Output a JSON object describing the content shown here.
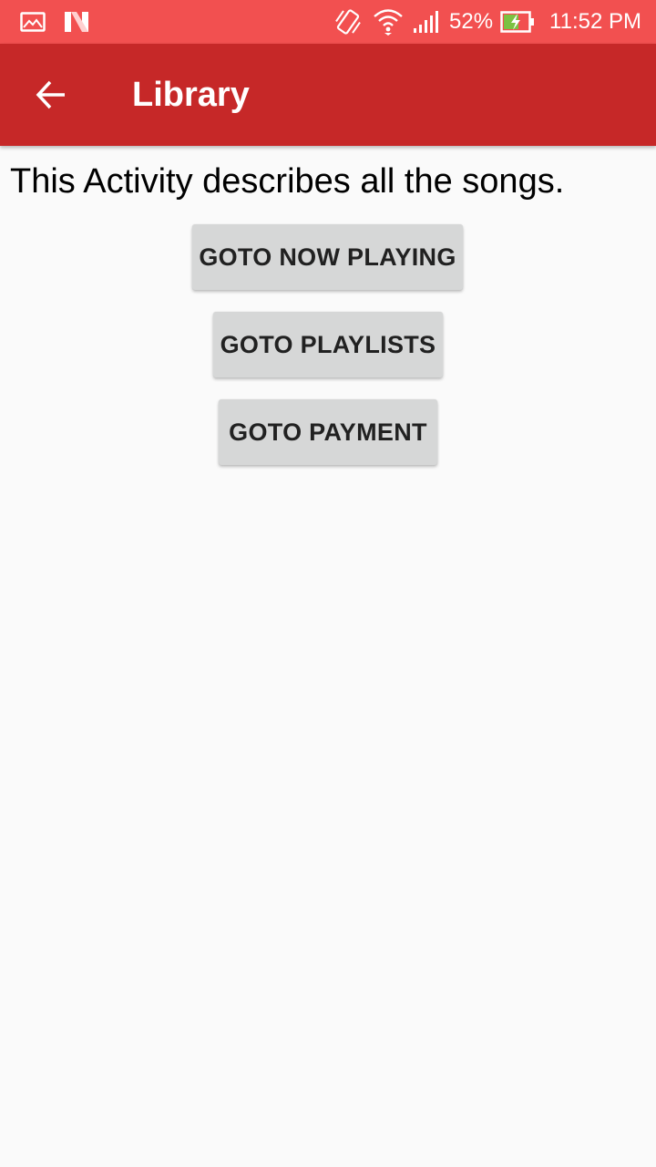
{
  "status_bar": {
    "battery_percent": "52%",
    "time": "11:52 PM",
    "icons": [
      "image-icon",
      "n-logo-icon",
      "vibrate-icon",
      "wifi-icon",
      "signal-icon",
      "battery-charging-icon"
    ]
  },
  "app_bar": {
    "title": "Library",
    "back_icon": "arrow-back-icon",
    "color": "#c62828"
  },
  "main": {
    "description": "This Activity describes all the songs.",
    "buttons": [
      {
        "label": "GOTO NOW PLAYING"
      },
      {
        "label": "GOTO PLAYLISTS"
      },
      {
        "label": "GOTO PAYMENT"
      }
    ]
  },
  "colors": {
    "status_bar": "#f25050",
    "app_bar": "#c62828",
    "background": "#fafafa",
    "button": "#d6d7d7",
    "battery_charge": "#7cc242"
  }
}
